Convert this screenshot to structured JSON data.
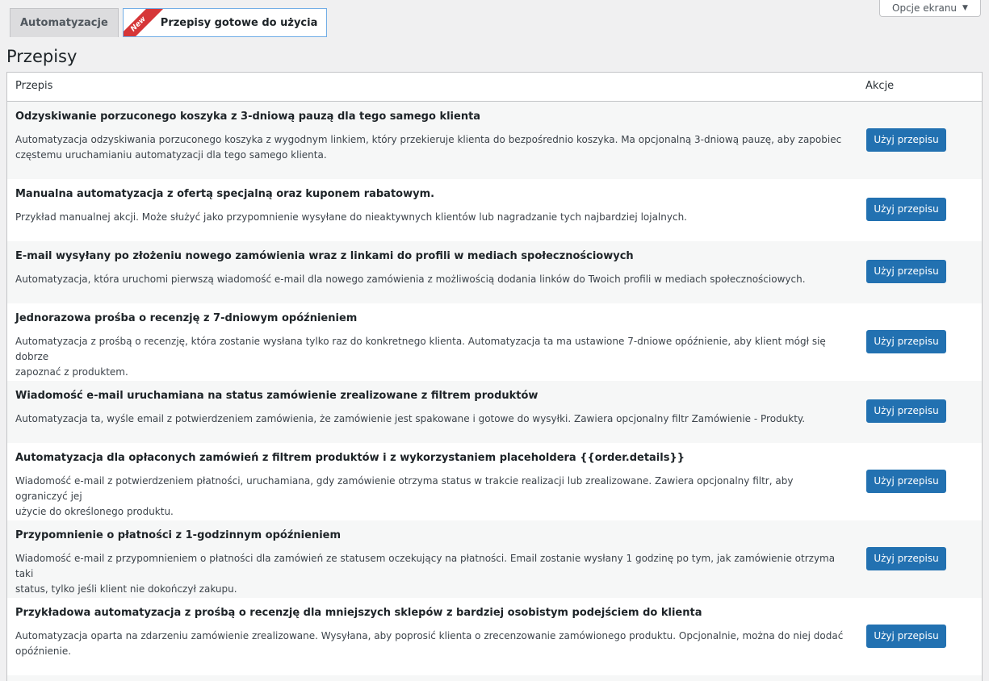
{
  "screen_options": {
    "label": "Opcje ekranu",
    "icon": "caret-down-icon"
  },
  "tabs": [
    {
      "label": "Automatyzacje",
      "active": false
    },
    {
      "label": "Przepisy gotowe do użycia",
      "active": true,
      "badge": "New"
    }
  ],
  "page_title": "Przepisy",
  "table": {
    "columns": {
      "name": "Przepis",
      "actions": "Akcje"
    },
    "button_label": "Użyj przepisu",
    "rows": [
      {
        "title": "Odzyskiwanie porzuconego koszyka z 3-dniową pauzą dla tego samego klienta",
        "desc1": "Automatyzacja odzyskiwania porzuconego koszyka z wygodnym linkiem, który przekieruje klienta do bezpośrednio koszyka. Ma opcjonalną 3-dniową pauzę, aby zapobiec",
        "desc2": "częstemu uruchamianiu automatyzacji dla tego samego klienta."
      },
      {
        "title": "Manualna automatyzacja z ofertą specjalną oraz kuponem rabatowym.",
        "desc1": "Przykład manualnej akcji. Może służyć jako przypomnienie wysyłane do nieaktywnych klientów lub nagradzanie tych najbardziej lojalnych.",
        "desc2": ""
      },
      {
        "title": "E-mail wysyłany po złożeniu nowego zamówienia wraz z linkami do profili w mediach społecznościowych",
        "desc1": "Automatyzacja, która uruchomi pierwszą wiadomość e-mail dla nowego zamówienia z możliwością dodania linków do Twoich profili w mediach społecznościowych.",
        "desc2": ""
      },
      {
        "title": "Jednorazowa prośba o recenzję z 7-dniowym opóźnieniem",
        "desc1": "Automatyzacja z prośbą o recenzję, która zostanie wysłana tylko raz do konkretnego klienta. Automatyzacja ta ma ustawione 7-dniowe opóźnienie, aby klient mógł się dobrze",
        "desc2": "zapoznać z produktem."
      },
      {
        "title": "Wiadomość e-mail uruchamiana na status zamówienie zrealizowane z filtrem produktów",
        "desc1": "Automatyzacja ta, wyśle email z potwierdzeniem zamówienia, że zamówienie jest spakowane i gotowe do wysyłki. Zawiera opcjonalny filtr Zamówienie - Produkty.",
        "desc2": ""
      },
      {
        "title": "Automatyzacja dla opłaconych zamówień z filtrem produktów i z wykorzystaniem placeholdera {{order.details}}",
        "desc1": "Wiadomość e-mail z potwierdzeniem płatności, uruchamiana, gdy zamówienie otrzyma status w trakcie realizacji lub zrealizowane. Zawiera opcjonalny filtr, aby ograniczyć jej",
        "desc2": "użycie do określonego produktu."
      },
      {
        "title": "Przypomnienie o płatności z 1-godzinnym opóźnieniem",
        "desc1": "Wiadomość e-mail z przypomnieniem o płatności dla zamówień ze statusem oczekujący na płatności. Email zostanie wysłany 1 godzinę po tym, jak zamówienie otrzyma taki",
        "desc2": "status, tylko jeśli klient nie dokończył zakupu."
      },
      {
        "title": "Przykładowa automatyzacja z prośbą o recenzję dla mniejszych sklepów z bardziej osobistym podejściem do klienta",
        "desc1": "Automatyzacja oparta na zdarzeniu zamówienie zrealizowane. Wysyłana, aby poprosić klienta o zrecenzowanie zamówionego produktu. Opcjonalnie, można do niej dodać",
        "desc2": "opóźnienie."
      }
    ]
  }
}
